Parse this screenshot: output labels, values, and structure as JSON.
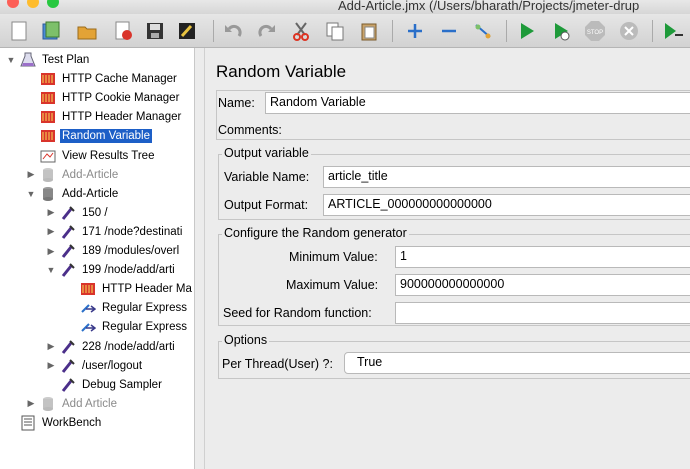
{
  "window": {
    "title": "Add-Article.jmx (/Users/bharath/Projects/jmeter-drup"
  },
  "toolbar": {
    "buttons": [
      "new-icon",
      "templates-icon",
      "open-icon",
      "close-icon",
      "save-icon",
      "edit-icon",
      "undo-icon",
      "redo-icon",
      "cut-icon",
      "copy-icon",
      "paste-icon",
      "expand-icon",
      "collapse-icon",
      "toggle-icon",
      "start-icon",
      "start-no-pause-icon",
      "stop-icon",
      "shutdown-icon",
      "remote-start-icon"
    ]
  },
  "tree": {
    "nodes": [
      {
        "label": "Test Plan",
        "icon": "test-plan-icon",
        "level": 0,
        "arrow": "expanded"
      },
      {
        "label": "HTTP Cache Manager",
        "icon": "config-element-icon",
        "level": 1,
        "arrow": ""
      },
      {
        "label": "HTTP Cookie Manager",
        "icon": "config-element-icon",
        "level": 1,
        "arrow": ""
      },
      {
        "label": "HTTP Header Manager",
        "icon": "config-element-icon",
        "level": 1,
        "arrow": ""
      },
      {
        "label": "Random Variable",
        "icon": "config-element-icon",
        "level": 1,
        "arrow": "",
        "selected": true
      },
      {
        "label": "View Results Tree",
        "icon": "listener-icon",
        "level": 1,
        "arrow": ""
      },
      {
        "label": "Add-Article",
        "icon": "thread-group-icon",
        "level": 1,
        "arrow": "collapsed",
        "disabled": true
      },
      {
        "label": "Add-Article",
        "icon": "thread-group-icon",
        "level": 1,
        "arrow": "expanded"
      },
      {
        "label": "150 /",
        "icon": "sampler-icon",
        "level": 2,
        "arrow": "collapsed"
      },
      {
        "label": "171 /node?destinati",
        "icon": "sampler-icon",
        "level": 2,
        "arrow": "collapsed"
      },
      {
        "label": "189 /modules/overl",
        "icon": "sampler-icon",
        "level": 2,
        "arrow": "collapsed"
      },
      {
        "label": "199 /node/add/arti",
        "icon": "sampler-icon",
        "level": 2,
        "arrow": "expanded"
      },
      {
        "label": "HTTP Header Ma",
        "icon": "config-element-icon",
        "level": 3,
        "arrow": ""
      },
      {
        "label": "Regular Express",
        "icon": "extractor-icon",
        "level": 3,
        "arrow": ""
      },
      {
        "label": "Regular Express",
        "icon": "extractor-icon",
        "level": 3,
        "arrow": ""
      },
      {
        "label": "228 /node/add/arti",
        "icon": "sampler-icon",
        "level": 2,
        "arrow": "collapsed"
      },
      {
        "label": "/user/logout",
        "icon": "sampler-icon",
        "level": 2,
        "arrow": "collapsed"
      },
      {
        "label": "Debug Sampler",
        "icon": "sampler-icon",
        "level": 2,
        "arrow": ""
      },
      {
        "label": "Add Article",
        "icon": "thread-group-icon",
        "level": 1,
        "arrow": "collapsed",
        "disabled": true
      },
      {
        "label": "WorkBench",
        "icon": "workbench-icon",
        "level": 0,
        "arrow": ""
      }
    ]
  },
  "form": {
    "heading": "Random Variable",
    "name_label": "Name:",
    "name_value": "Random Variable",
    "comments_label": "Comments:",
    "comments_value": "",
    "output_group": "Output variable",
    "variable_name_label": "Variable Name:",
    "variable_name_value": "article_title",
    "output_format_label": "Output Format:",
    "output_format_value": "ARTICLE_000000000000000",
    "random_group": "Configure the Random generator",
    "min_label": "Minimum Value:",
    "min_value": "1",
    "max_label": "Maximum Value:",
    "max_value": "900000000000000",
    "seed_label": "Seed for Random function:",
    "seed_value": "",
    "options_group": "Options",
    "per_thread_label": "Per Thread(User) ?:",
    "per_thread_value": "True"
  },
  "colors": {
    "selection": "#1d5fc7",
    "close": "#fd5f57",
    "minimize": "#febc2e",
    "maximize": "#28c840"
  }
}
